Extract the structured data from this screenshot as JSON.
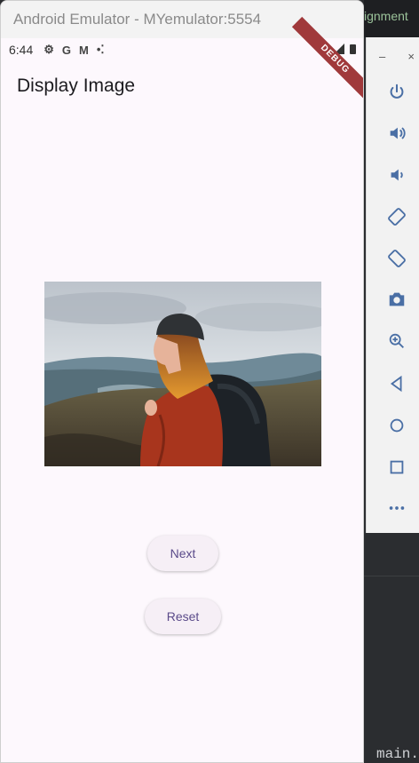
{
  "emulator": {
    "window_title": "Android Emulator - MYemulator:5554",
    "debug_banner": "DEBUG"
  },
  "status_bar": {
    "time": "6:44",
    "notif_icons": [
      "gear-icon",
      "google-icon",
      "gmail-icon",
      "dots-icon"
    ]
  },
  "app": {
    "title": "Display Image",
    "next_label": "Next",
    "reset_label": "Reset"
  },
  "ide": {
    "top_text": "ignment",
    "bottom_text": "main."
  },
  "emulator_sidebar": {
    "minimize": "–",
    "close": "×",
    "icons": [
      "power-icon",
      "volume-up-icon",
      "volume-down-icon",
      "rotate-left-icon",
      "rotate-right-icon",
      "camera-icon",
      "zoom-icon",
      "back-icon",
      "home-icon",
      "overview-icon",
      "more-icon"
    ]
  },
  "colors": {
    "accent": "#5b4b8a",
    "app_background": "#fdf8fd",
    "button_background": "#f6eff6",
    "debug_ribbon": "#a0393b"
  }
}
